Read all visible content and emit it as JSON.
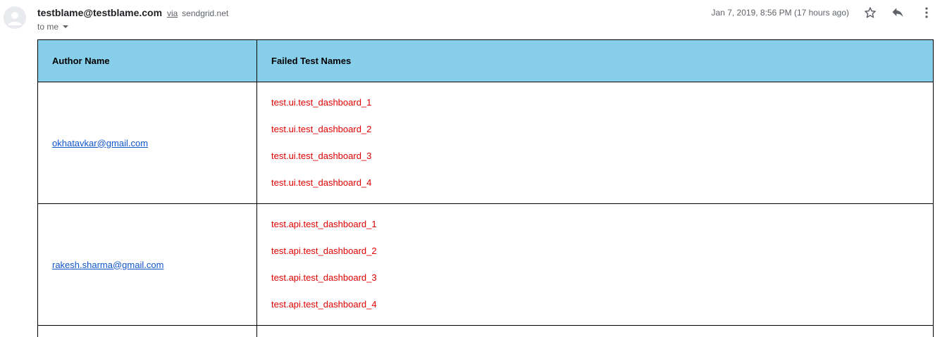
{
  "email": {
    "sender": "testblame@testblame.com",
    "via_label": "via",
    "via_domain": "sendgrid.net",
    "to_label": "to me",
    "date": "Jan 7, 2019, 8:56 PM (17 hours ago)"
  },
  "table": {
    "headers": [
      "Author Name",
      "Failed Test Names"
    ],
    "rows": [
      {
        "author": "okhatavkar@gmail.com",
        "tests": [
          "test.ui.test_dashboard_1",
          "test.ui.test_dashboard_2",
          "test.ui.test_dashboard_3",
          "test.ui.test_dashboard_4"
        ]
      },
      {
        "author": "rakesh.sharma@gmail.com",
        "tests": [
          "test.api.test_dashboard_1",
          "test.api.test_dashboard_2",
          "test.api.test_dashboard_3",
          "test.api.test_dashboard_4"
        ]
      }
    ]
  },
  "icons": {
    "avatar": "avatar-placeholder-icon",
    "star": "star-icon",
    "reply": "reply-icon",
    "more": "more-vert-icon"
  },
  "colors": {
    "header_bg": "#87ceeb",
    "link": "#1155cc",
    "failed_test": "#e00000"
  }
}
